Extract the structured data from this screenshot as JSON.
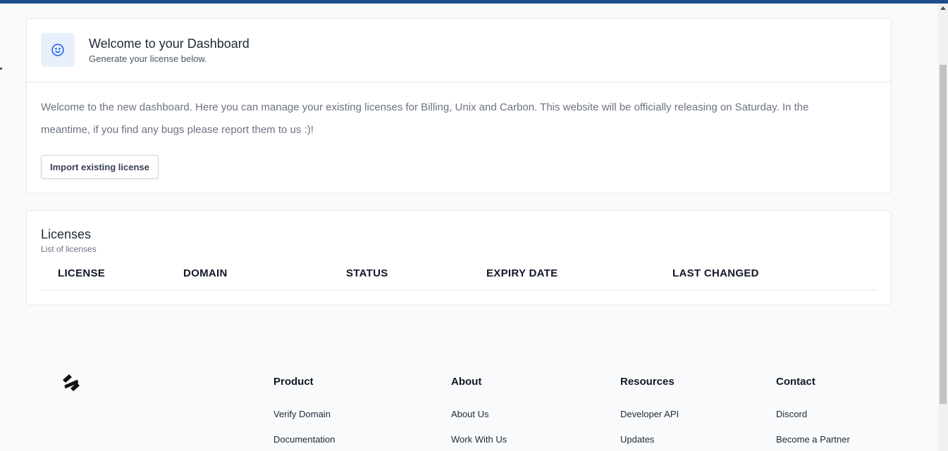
{
  "welcome": {
    "title": "Welcome to your Dashboard",
    "subtitle": "Generate your license below.",
    "icon": "smiley-icon",
    "body": "Welcome to the new dashboard. Here you can manage your existing licenses for Billing, Unix and Carbon. This website will be officially releasing on Saturday. In the meantime, if you find any bugs please report them to us :)!",
    "import_button": "Import existing license"
  },
  "licenses": {
    "title": "Licenses",
    "subtitle": "List of licenses",
    "columns": [
      "LICENSE",
      "DOMAIN",
      "STATUS",
      "EXPIRY DATE",
      "LAST CHANGED"
    ],
    "rows": []
  },
  "footer": {
    "logo_icon": "brand-logo-icon",
    "columns": [
      {
        "title": "Product",
        "links": [
          "Verify Domain",
          "Documentation"
        ]
      },
      {
        "title": "About",
        "links": [
          "About Us",
          "Work With Us"
        ]
      },
      {
        "title": "Resources",
        "links": [
          "Developer API",
          "Updates"
        ]
      },
      {
        "title": "Contact",
        "links": [
          "Discord",
          "Become a Partner"
        ]
      }
    ]
  },
  "colors": {
    "topbar": "#1f4e8c",
    "accent": "#2563eb",
    "icon_bg": "#e8f0fd"
  }
}
